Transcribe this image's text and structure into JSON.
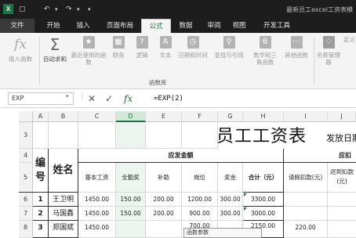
{
  "titlebar": {
    "app_icon": "X",
    "save_icon": "save-icon",
    "undo_icon": "undo-icon",
    "redo_icon": "redo-icon",
    "doc_title": "最新员工excel工资表模"
  },
  "tabs": [
    "文件",
    "开始",
    "插入",
    "页面布局",
    "公式",
    "数据",
    "审阅",
    "视图",
    "开发工具"
  ],
  "ribbon": {
    "insert_function": "插入函数",
    "autosum": "自动求和",
    "recent": "最近使用的函数",
    "financial": "财务",
    "logical": "逻辑",
    "text": "文本",
    "datetime": "日期和时间",
    "lookup": "查找与引用",
    "math": "数学和三角函数",
    "other": "其他函数",
    "name_manager": "名称管理器",
    "define": "定义",
    "group_label": "函数库"
  },
  "formula_bar": {
    "name_box": "EXP",
    "cancel_icon": "cancel-icon",
    "enter_icon": "enter-icon",
    "fx": "fx",
    "formula": "=EXP(2)"
  },
  "columns": [
    "A",
    "B",
    "C",
    "D",
    "E",
    "F",
    "G",
    "H",
    "I",
    "J"
  ],
  "rows": [
    "3",
    "4",
    "5",
    "6",
    "7",
    "8"
  ],
  "sheet": {
    "title": "员工工资表",
    "date_label": "发放日期",
    "header_group_pay": "应发金额",
    "header_group_deduct": "应扣",
    "col_no": "编号",
    "col_name": "姓名",
    "col_basic": "基本工资",
    "col_attendance": "全勤奖",
    "col_subsidy": "补助",
    "col_post": "岗位",
    "col_bonus": "奖金",
    "col_total": "合计（元）",
    "col_leave": "请假扣款(元)",
    "col_late": "迟到扣款(元)",
    "employees": [
      {
        "no": "1",
        "name": "王卫明",
        "basic": "1450.00",
        "attendance": "150.00",
        "subsidy": "200.00",
        "post": "1200.00",
        "bonus": "300.00",
        "total": "3300.00",
        "leave": ""
      },
      {
        "no": "2",
        "name": "马国鑫",
        "basic": "1450.00",
        "attendance": "150.00",
        "subsidy": "200.00",
        "post": "900.00",
        "bonus": "300.00",
        "total": "3000.00",
        "leave": ""
      },
      {
        "no": "3",
        "name": "郑国斌",
        "basic": "1450.00",
        "attendance": "",
        "subsidy": "",
        "post": "700.00",
        "bonus": "",
        "total": "2150.00",
        "leave": "220.00"
      }
    ]
  },
  "tooltip": "函数参数"
}
